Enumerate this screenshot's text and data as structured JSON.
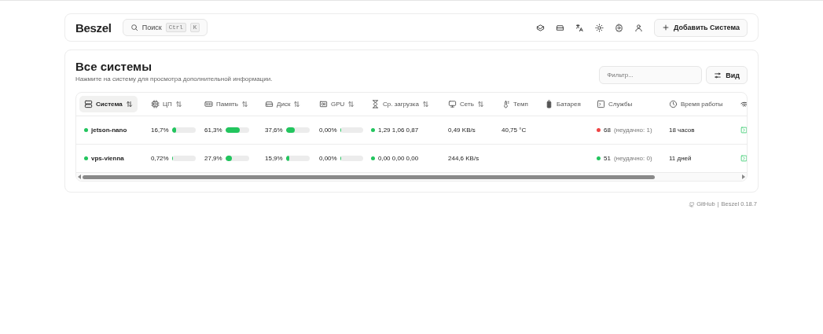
{
  "header": {
    "logo": "Beszel",
    "search": {
      "label": "Поиск",
      "keys": [
        "Ctrl",
        "K"
      ]
    },
    "add_button": "Добавить Система"
  },
  "systems": {
    "title": "Все системы",
    "subtitle": "Нажмите на систему для просмотра дополнительной информации.",
    "filter": {
      "placeholder": "Фильтр..."
    },
    "view_button": "Вид",
    "columns": [
      {
        "label": "Система",
        "sortable": true,
        "selected": true
      },
      {
        "label": "ЦП",
        "sortable": true,
        "selected": false
      },
      {
        "label": "Память",
        "sortable": true,
        "selected": false
      },
      {
        "label": "Диск",
        "sortable": true,
        "selected": false
      },
      {
        "label": "GPU",
        "sortable": true,
        "selected": false
      },
      {
        "label": "Ср. загрузка",
        "sortable": true,
        "selected": false
      },
      {
        "label": "Сеть",
        "sortable": true,
        "selected": false
      },
      {
        "label": "Темп",
        "sortable": false,
        "selected": false
      },
      {
        "label": "Батарея",
        "sortable": false,
        "selected": false
      },
      {
        "label": "Службы",
        "sortable": false,
        "selected": false
      },
      {
        "label": "Время работы",
        "sortable": false,
        "selected": false
      }
    ],
    "rows": [
      {
        "name": "jetson-nano",
        "color": "#22c55e",
        "cpu": {
          "text": "16,7%",
          "level": 0.167
        },
        "memory": {
          "text": "61,3%",
          "level": 0.613
        },
        "disk": {
          "text": "37,6%",
          "level": 0.376
        },
        "gpu": {
          "text": "0,00%",
          "level": 0
        },
        "load": {
          "color": "#22c55e",
          "text": "1,29 1,06 0,87"
        },
        "network": "0,49 KB/s",
        "temp": "40,75 °C",
        "services": {
          "color": "#ef4444",
          "count": "68",
          "failed": "(неудачно: 1)"
        },
        "uptime": "18 часов"
      },
      {
        "name": "vps-vienna",
        "color": "#22c55e",
        "cpu": {
          "text": "0,72%",
          "level": 0.0072
        },
        "memory": {
          "text": "27,9%",
          "level": 0.279
        },
        "disk": {
          "text": "15,9%",
          "level": 0.159
        },
        "gpu": {
          "text": "0,00%",
          "level": 0
        },
        "load": {
          "color": "#22c55e",
          "text": "0,00 0,00 0,00"
        },
        "network": "244,6 KB/s",
        "services": {
          "color": "#22c55e",
          "count": "51",
          "failed": "(неудачно: 0)"
        },
        "uptime": "11 дней"
      }
    ]
  },
  "footer": {
    "link": "GitHub",
    "separator": "|",
    "version": "Beszel 0.18.7"
  }
}
